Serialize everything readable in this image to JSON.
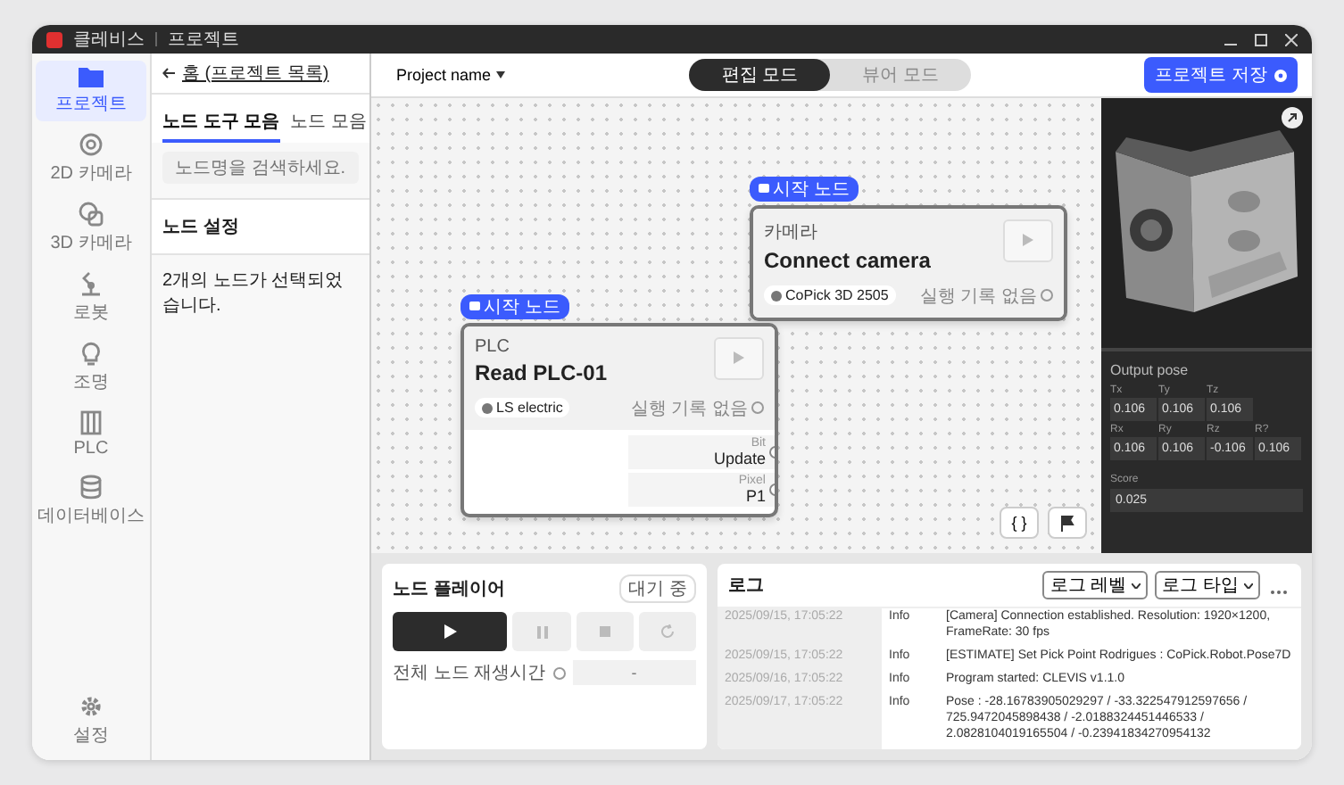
{
  "window": {
    "app_name": "클레비스",
    "title": "프로젝트"
  },
  "sidebar": {
    "items": [
      {
        "label": "프로젝트",
        "kind": "folder",
        "selected": true
      },
      {
        "label": "2D 카메라",
        "kind": "aperture",
        "selected": false
      },
      {
        "label": "3D 카메라",
        "kind": "camera3d",
        "selected": false
      },
      {
        "label": "로봇",
        "kind": "robot",
        "selected": false
      },
      {
        "label": "조명",
        "kind": "bulb",
        "selected": false
      },
      {
        "label": "PLC",
        "kind": "plc",
        "selected": false
      },
      {
        "label": "데이터베이스",
        "kind": "database",
        "selected": false
      }
    ],
    "footer": {
      "label": "설정",
      "kind": "gear",
      "selected": false
    }
  },
  "left_panel": {
    "back_link": "홈 (프로젝트 목록)",
    "tabs": [
      {
        "label": "노드 도구 모음",
        "selected": true
      },
      {
        "label": "노드 모음",
        "selected": false
      }
    ],
    "search": {
      "placeholder": "노드명을 검색하세요."
    },
    "settings_title": "노드 설정",
    "settings_message": "2개의 노드가 선택되었습니다."
  },
  "toolbar": {
    "project_name": "Project name",
    "modes": [
      {
        "label": "편집 모드",
        "selected": true
      },
      {
        "label": "뷰어 모드",
        "selected": false
      }
    ],
    "save_button": "프로젝트 저장"
  },
  "nodes": [
    {
      "badge": "시작 노드",
      "category": "카메라",
      "title": "Connect camera",
      "device": "CoPick 3D 2505",
      "status": "실행 기록 없음"
    },
    {
      "badge": "시작 노드",
      "category": "PLC",
      "title": "Read PLC-01",
      "device": "LS electric",
      "status": "실행 기록 없음",
      "ports": [
        {
          "label": "Bit",
          "value": "Update"
        },
        {
          "label": "Pixel",
          "value": "P1"
        }
      ]
    }
  ],
  "canvas_tools": {
    "code_button": "{ }"
  },
  "output_pose": {
    "title": "Output pose",
    "rows": [
      [
        {
          "label": "Tx",
          "value": "0.106"
        },
        {
          "label": "Ty",
          "value": "0.106"
        },
        {
          "label": "Tz",
          "value": "0.106"
        }
      ],
      [
        {
          "label": "Rx",
          "value": "0.106"
        },
        {
          "label": "Ry",
          "value": "0.106"
        },
        {
          "label": "Rz",
          "value": "-0.106"
        },
        {
          "label": "R?",
          "value": "0.106"
        }
      ]
    ],
    "score": {
      "label": "Score",
      "value": "0.025"
    }
  },
  "player": {
    "title": "노드 플레이어",
    "status": "대기 중",
    "total_label": "전체 노드 재생시간",
    "total_value": "-"
  },
  "log": {
    "title": "로그",
    "filters": [
      "로그 레벨",
      "로그 타입"
    ],
    "rows": [
      {
        "time": "2025/09/15, 17:05:22",
        "level": "Info",
        "message": "[Camera] Connection established. Resolution: 1920×1200, FrameRate: 30 fps"
      },
      {
        "time": "2025/09/15, 17:05:22",
        "level": "Info",
        "message": "[ESTIMATE] Set Pick Point Rodrigues : CoPick.Robot.Pose7D"
      },
      {
        "time": "2025/09/16, 17:05:22",
        "level": "Info",
        "message": "Program started: CLEVIS v1.1.0"
      },
      {
        "time": "2025/09/17, 17:05:22",
        "level": "Info",
        "message": "Pose : -28.16783905029297 / -33.322547912597656 / 725.9472045898438 / -2.0188324451446533 / 2.0828104019165504 / -0.23941834270954132"
      }
    ]
  }
}
